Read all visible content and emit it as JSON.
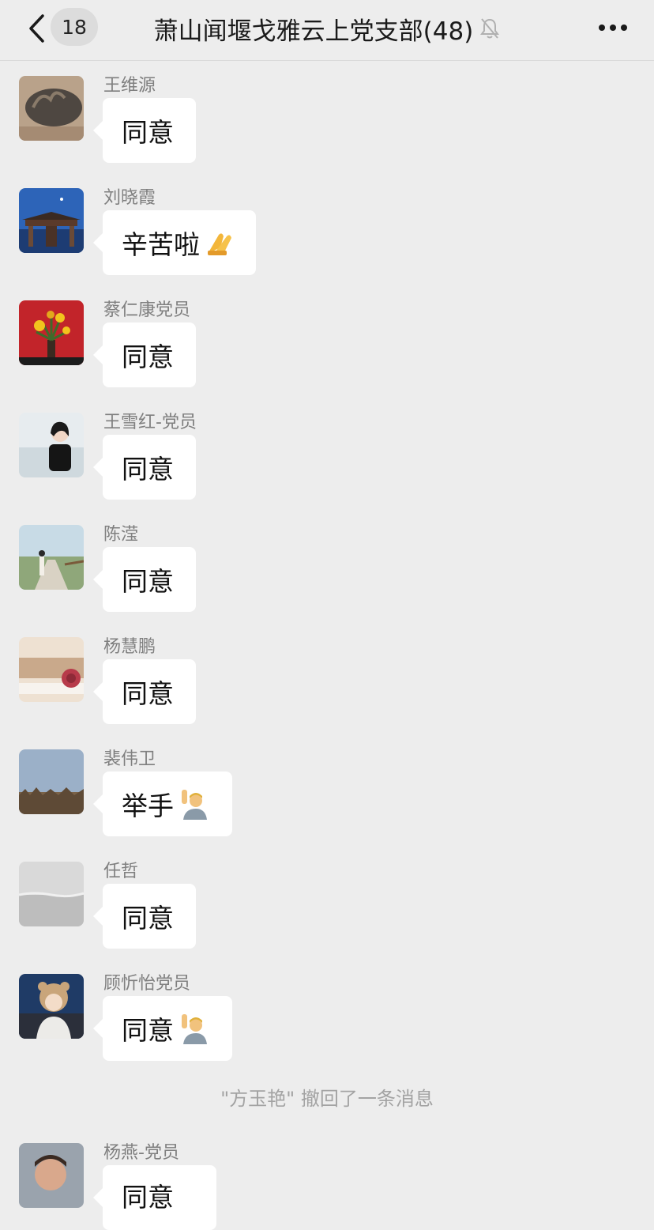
{
  "header": {
    "back_icon": "chevron-left-icon",
    "unread_count": "18",
    "group_name": "萧山闻堰戈雅云上党支部(48)",
    "mute_icon": "bell-muted-icon",
    "more_icon": "more-dots-icon"
  },
  "messages": [
    {
      "sender": "王维源",
      "text": "同意"
    },
    {
      "sender": "刘晓霞",
      "text": "辛苦啦",
      "emoji": "praying-hands-emoji"
    },
    {
      "sender": "蔡仁康党员",
      "text": "同意"
    },
    {
      "sender": "王雪红-党员",
      "text": "同意"
    },
    {
      "sender": "陈滢",
      "text": "同意"
    },
    {
      "sender": "杨慧鹏",
      "text": "同意"
    },
    {
      "sender": "裴伟卫",
      "text": "举手",
      "emoji": "person-raising-hand-emoji"
    },
    {
      "sender": "任哲",
      "text": "同意"
    },
    {
      "sender": "顾忻怡党员",
      "text": "同意",
      "emoji": "person-raising-hand-emoji"
    }
  ],
  "system_notice": "\"方玉艳\" 撤回了一条消息",
  "last_message": {
    "sender": "杨燕-党员",
    "text": "同意"
  }
}
